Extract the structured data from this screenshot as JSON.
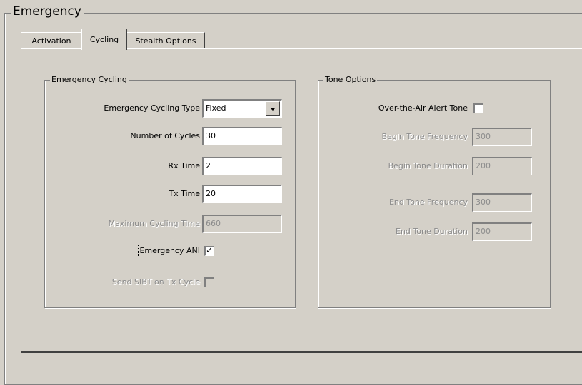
{
  "title": "Emergency",
  "tabs": [
    {
      "label": "Activation",
      "active": false
    },
    {
      "label": "Cycling",
      "active": true
    },
    {
      "label": "Stealth Options",
      "active": false
    }
  ],
  "cycling": {
    "group_title": "Emergency Cycling",
    "type_label": "Emergency Cycling Type",
    "type_value": "Fixed",
    "cycles_label": "Number of Cycles",
    "cycles_value": "30",
    "rx_label": "Rx Time",
    "rx_value": "2",
    "tx_label": "Tx Time",
    "tx_value": "20",
    "max_label": "Maximum Cycling Time",
    "max_value": "660",
    "ani_label": "Emergency ANI",
    "ani_checked": true,
    "sibt_label": "Send SIBT on Tx Cycle",
    "sibt_checked": false
  },
  "tone": {
    "group_title": "Tone Options",
    "alert_label": "Over-the-Air Alert Tone",
    "alert_checked": false,
    "begin_freq_label": "Begin Tone Frequency",
    "begin_freq_value": "300",
    "begin_dur_label": "Begin Tone Duration",
    "begin_dur_value": "200",
    "end_freq_label": "End Tone Frequency",
    "end_freq_value": "300",
    "end_dur_label": "End Tone Duration",
    "end_dur_value": "200"
  },
  "colors": {
    "background": "#d4d0c8",
    "disabled_text": "#8c8c8c"
  }
}
